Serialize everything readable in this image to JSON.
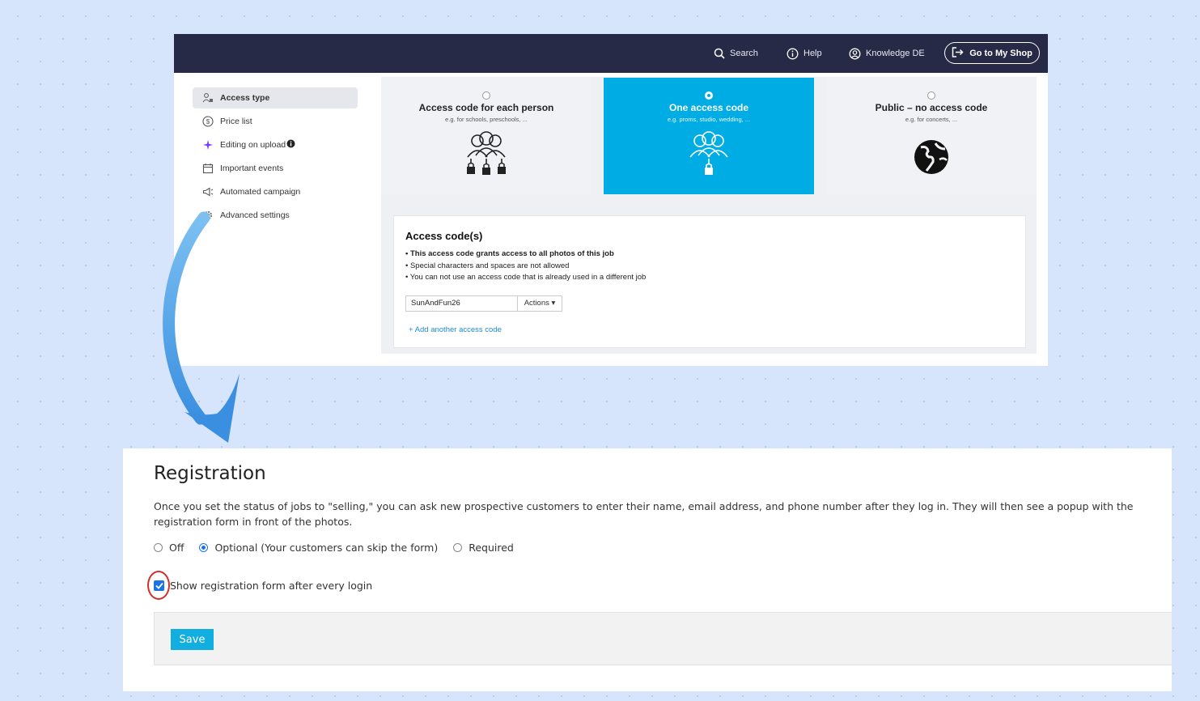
{
  "topbar": {
    "search_label": "Search",
    "help_label": "Help",
    "knowledge_label": "Knowledge DE",
    "shop_button_label": "Go to My Shop",
    "background_color": "#272a47"
  },
  "sidebar": {
    "items": [
      {
        "label": "Access type",
        "icon": "user-lock-icon",
        "active": true
      },
      {
        "label": "Price list",
        "icon": "dollar-circle-icon",
        "active": false
      },
      {
        "label": "Editing on upload",
        "icon": "sparkle-icon",
        "active": false
      },
      {
        "label": "Important events",
        "icon": "calendar-icon",
        "active": false
      },
      {
        "label": "Automated campaign",
        "icon": "megaphone-icon",
        "active": false
      },
      {
        "label": "Advanced settings",
        "icon": "gear-icon",
        "active": false
      }
    ]
  },
  "access_types": [
    {
      "title": "Access code for each person",
      "subtitle": "e.g. for schools, preschools, ...",
      "selected": false,
      "icon": "group-multiple-locks-icon"
    },
    {
      "title": "One access code",
      "subtitle": "e.g. proms, studio, wedding, ...",
      "selected": true,
      "icon": "group-single-lock-icon"
    },
    {
      "title": "Public – no access code",
      "subtitle": "e.g. for concerts, ...",
      "selected": false,
      "icon": "globe-icon"
    }
  ],
  "access_codes": {
    "title": "Access code(s)",
    "rules": [
      "This access code grants access to all photos of this job",
      "Special characters and spaces are not allowed",
      "You can not use an access code that is already used in a different job"
    ],
    "code_value": "SunAndFun26",
    "actions_label": "Actions ▾",
    "add_label": "+ Add another access code"
  },
  "registration": {
    "title": "Registration",
    "description": "Once you set the status of jobs to \"selling,\" you can ask new prospective customers to enter their name, email address, and phone number after they log in. They will then see a popup with the registration form in front of the photos.",
    "options": [
      {
        "label": "Off",
        "selected": false
      },
      {
        "label": "Optional (Your customers can skip the form)",
        "selected": true
      },
      {
        "label": "Required",
        "selected": false
      }
    ],
    "checkbox_label": "Show registration form after every login",
    "checkbox_checked": true,
    "save_label": "Save"
  },
  "colors": {
    "accent": "#00ace4",
    "highlight_circle": "#d0302a",
    "checkbox": "#1a73e8"
  }
}
